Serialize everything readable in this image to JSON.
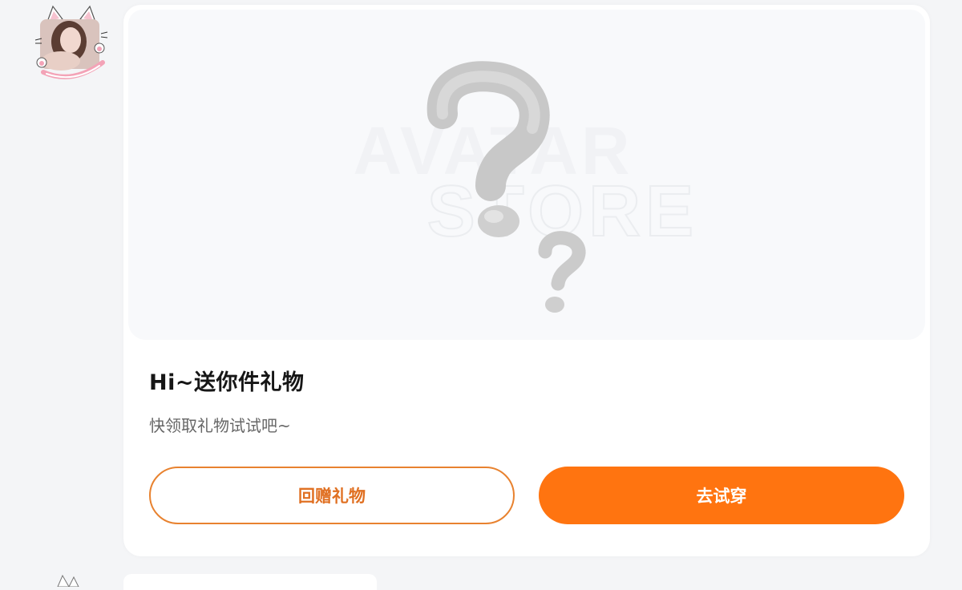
{
  "message": {
    "title": "Hi~送你件礼物",
    "subtitle": "快领取礼物试试吧~",
    "preview_watermark": {
      "line1": "AVATAR",
      "line2": "STORE"
    },
    "actions": {
      "return_gift": "回赠礼物",
      "try_on": "去试穿"
    }
  },
  "colors": {
    "accent": "#ff7410",
    "accent_outline": "#e8822f",
    "page_background": "#f4f5f7"
  }
}
